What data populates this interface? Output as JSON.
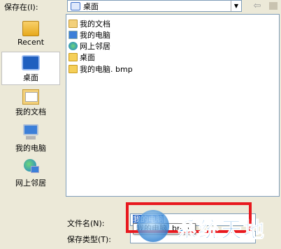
{
  "toolbar": {
    "save_in_label": "保存在(I):",
    "location": "桌面",
    "dropdown_glyph": "▼",
    "back_glyph": "⇦"
  },
  "places": [
    {
      "label": "Recent",
      "icon": "recent-folder-icon"
    },
    {
      "label": "桌面",
      "icon": "desktop-icon",
      "selected": true
    },
    {
      "label": "我的文档",
      "icon": "my-documents-icon"
    },
    {
      "label": "我的电脑",
      "icon": "my-computer-icon"
    },
    {
      "label": "网上邻居",
      "icon": "network-places-icon"
    }
  ],
  "files": [
    {
      "name": "我的文档",
      "icon": "my-documents-icon"
    },
    {
      "name": "我的电脑",
      "icon": "my-computer-icon"
    },
    {
      "name": "网上邻居",
      "icon": "network-places-icon"
    },
    {
      "name": "桌面",
      "icon": "folder-icon"
    },
    {
      "name": "我的电脑. bmp",
      "icon": "bmp-file-icon"
    }
  ],
  "filename": {
    "label": "文件名(N):",
    "value": "我的电脑"
  },
  "filetype": {
    "label": "保存类型(T):"
  },
  "autocomplete": {
    "suggestion": "我的电脑. bmp"
  },
  "watermark": {
    "text": "系统天地"
  },
  "colors": {
    "highlight": "#e8191f",
    "selection": "#316ac5",
    "watermark": "#1d82d8"
  }
}
